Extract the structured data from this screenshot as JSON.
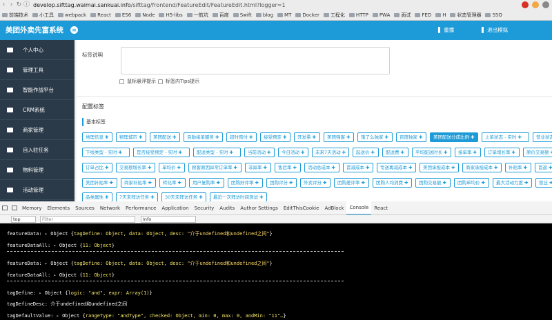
{
  "browser": {
    "url_host": "develop.sifttag.waimai.sankuai.info",
    "url_path": "/sifttag/frontend/FeatureEdit/FeatureEdit.html?logger=1",
    "bookmarks": [
      "前端技术",
      "小工具",
      "webpack",
      "React",
      "ES6",
      "Node",
      "H5-libs",
      "一航坑",
      "百度",
      "Swift",
      "blog",
      "MT",
      "Docker",
      "工程化",
      "HTTP",
      "PWA",
      "面试",
      "FED",
      "H",
      "状态管理器",
      "SSO"
    ]
  },
  "app": {
    "title": "美团外卖先富系统",
    "toggle_symbol": "≡",
    "top_actions": [
      "重播",
      "退出模拟"
    ]
  },
  "sidebar": {
    "items": [
      {
        "label": "个人中心",
        "icon": "user-icon"
      },
      {
        "label": "管理工具",
        "icon": "briefcase-icon"
      },
      {
        "label": "智能作战平台",
        "icon": "platform-icon"
      },
      {
        "label": "CRM系统",
        "icon": "crm-icon"
      },
      {
        "label": "商家管理",
        "icon": "shop-icon"
      },
      {
        "label": "自入驻任务",
        "icon": "task-icon"
      },
      {
        "label": "物料管理",
        "icon": "material-icon"
      },
      {
        "label": "活动管理",
        "icon": "activity-icon"
      }
    ]
  },
  "form": {
    "label_desc": "标签说明",
    "checkbox_hover": "鼠标悬浮提示",
    "checkbox_tips": "标签内Tips提示",
    "section_title": "配置标签",
    "basic_tags_title": "基本标签",
    "tag_rows": [
      [
        "地理信息",
        "物理城市",
        "美团配送",
        "自助接单服务",
        "超时赔付",
        "接受预定",
        "开发票",
        "美团强客",
        "饿了么独家",
        "百度独家",
        "美团配送分成比例",
        "上单状态 - 实时",
        "营业状态"
      ],
      [
        "下线类型 - 实时",
        "是否接受预定 - 实时",
        "配送类型 - 实时",
        "当前活动",
        "今日活动",
        "未来7天活动",
        "起送价",
        "配送费",
        "平均配送时长",
        "接单率",
        "订单增长率",
        "原价交易额"
      ],
      [
        "订单占比",
        "交易额增长率",
        "单均价",
        "顾客原因异常订单率",
        "非异率",
        "售后率",
        "活动总成本",
        "首减成本",
        "专送再减成本",
        "美团承担成本",
        "商家承担成本",
        "补贴率",
        "首返"
      ],
      [
        "美团补贴率",
        "商家补贴率",
        "转化率",
        "用户复购率",
        "团购好评率",
        "团购评分",
        "外卖评分",
        "团购差评率",
        "团购人均消费",
        "团购交易额",
        "团购单均价",
        "最大活动力度",
        "营业"
      ],
      [
        "品类属性",
        "7天未拜访任务",
        "30天未拜访任务",
        "最近一次拜访时间测试"
      ]
    ],
    "selected_tag": "美团配送分成比例",
    "plus_symbol": "✚"
  },
  "devtools": {
    "tabs": [
      "Memory",
      "Elements",
      "Sources",
      "Network",
      "Performance",
      "Application",
      "Security",
      "Audits",
      "Author Settings",
      "EditThisCookie",
      "AdBlock",
      "Console",
      "React"
    ],
    "active_tab": "Console",
    "context": "top",
    "filter_placeholder": "Filter",
    "level": "Info",
    "lines": [
      {
        "label": "featureData:",
        "prefix": "Object {",
        "body": "tagDefine: Object, data: Object, desc: ",
        "str": "\"介于undefined和undefined之间\"",
        "suffix": "}"
      },
      {
        "label": "featureDataAll:",
        "prefix": "Object {",
        "body": "11: Object",
        "str": "",
        "suffix": "}"
      },
      {
        "label": "featureData:",
        "prefix": "Object {",
        "body": "tagDefine: Object, data: Object, desc: ",
        "str": "\"介于undefined和undefined之间\"",
        "suffix": "}"
      },
      {
        "label": "featureDataAll:",
        "prefix": "Object {",
        "body": "11: Object",
        "str": "",
        "suffix": "}"
      },
      {
        "label": "tagDefine:",
        "prefix": "Object {",
        "body": "logic: \"and\", expr: Array(1)",
        "str": "",
        "suffix": "}"
      },
      {
        "label": "tagDefineDesc:",
        "prefix": "",
        "body": "介于undefined和undefined之间",
        "str": "",
        "suffix": ""
      },
      {
        "label": "tagDefaultValue:",
        "prefix": "Object {",
        "body": "rangeType: \"andType\", checked: Object, min: 0, max: 0, andMin: \"11\"…",
        "str": "",
        "suffix": "}"
      }
    ]
  },
  "colors": {
    "brand": "#1d9bd8",
    "sidebar": "#2b3a48",
    "console_bg": "#000000"
  }
}
